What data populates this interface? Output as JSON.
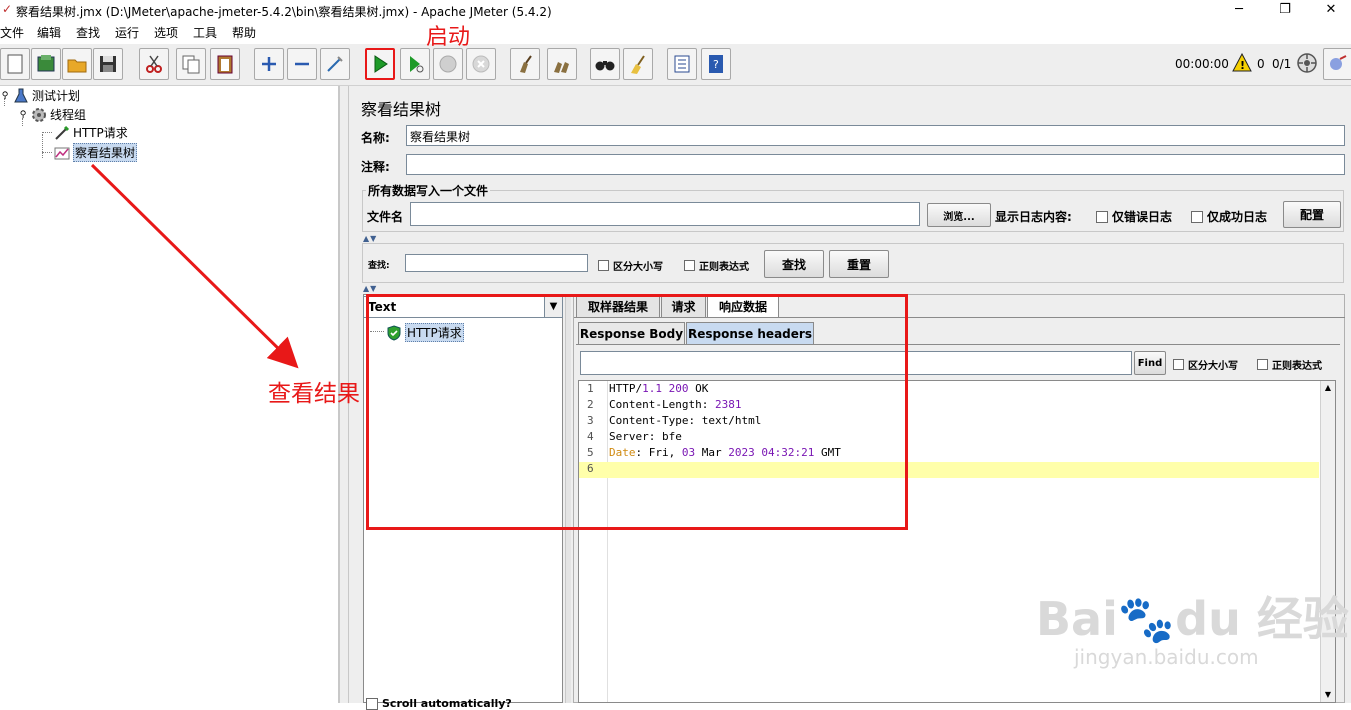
{
  "window": {
    "title": "察看结果树.jmx (D:\\JMeter\\apache-jmeter-5.4.2\\bin\\察看结果树.jmx) - Apache JMeter (5.4.2)",
    "controls": [
      "─",
      "❐",
      "✕"
    ]
  },
  "menu": [
    "文件",
    "编辑",
    "查找",
    "运行",
    "选项",
    "工具",
    "帮助"
  ],
  "toolbar": {
    "timer": "00:00:00",
    "warning_count": "0",
    "threads": "0/1"
  },
  "tree": {
    "test_plan": "测试计划",
    "thread_group": "线程组",
    "http_request": "HTTP请求",
    "view_results_tree": "察看结果树"
  },
  "panel": {
    "title": "察看结果树",
    "name_label": "名称:",
    "name_value": "察看结果树",
    "comment_label": "注释:",
    "comment_value": "",
    "file_group_title": "所有数据写入一个文件",
    "filename_label": "文件名",
    "filename_value": "",
    "browse_button": "浏览...",
    "log_content_label": "显示日志内容:",
    "errors_only": "仅错误日志",
    "success_only": "仅成功日志",
    "configure_button": "配置"
  },
  "search": {
    "label": "查找:",
    "value": "",
    "case_sensitive": "区分大小写",
    "regex": "正则表达式",
    "find_button": "查找",
    "reset_button": "重置"
  },
  "results": {
    "renderer": "Text",
    "items": [
      "HTTP请求"
    ],
    "scroll_auto": "Scroll automatically?"
  },
  "tabs": [
    "取样器结果",
    "请求",
    "响应数据"
  ],
  "subtabs": [
    "Response Body",
    "Response headers"
  ],
  "response_search": {
    "value": "",
    "find_button": "Find",
    "case_sensitive": "区分大小写",
    "regex": "正则表达式"
  },
  "response_headers": [
    {
      "n": "1",
      "parts": [
        [
          "HTTP/",
          ""
        ],
        [
          "1.1",
          "purple"
        ],
        [
          " ",
          ""
        ],
        [
          "200",
          "purple"
        ],
        [
          " OK",
          ""
        ]
      ]
    },
    {
      "n": "2",
      "parts": [
        [
          "Content-Length: ",
          ""
        ],
        [
          "2381",
          "purple"
        ]
      ]
    },
    {
      "n": "3",
      "parts": [
        [
          "Content-Type: text/html",
          ""
        ]
      ]
    },
    {
      "n": "4",
      "parts": [
        [
          "Server: bfe",
          ""
        ]
      ]
    },
    {
      "n": "5",
      "parts": [
        [
          "Date",
          "orange"
        ],
        [
          ": Fri, ",
          ""
        ],
        [
          "03",
          "purple"
        ],
        [
          " Mar ",
          ""
        ],
        [
          "2023",
          "purple"
        ],
        [
          " ",
          ""
        ],
        [
          "04:32:21",
          "purple"
        ],
        [
          " GMT",
          ""
        ]
      ]
    },
    {
      "n": "6",
      "parts": []
    }
  ],
  "annotations": {
    "start": "启动",
    "view_result": "查看结果"
  },
  "watermark": {
    "brand_b": "Bai",
    "brand_cn": "经验",
    "url": "jingyan.baidu.com"
  }
}
